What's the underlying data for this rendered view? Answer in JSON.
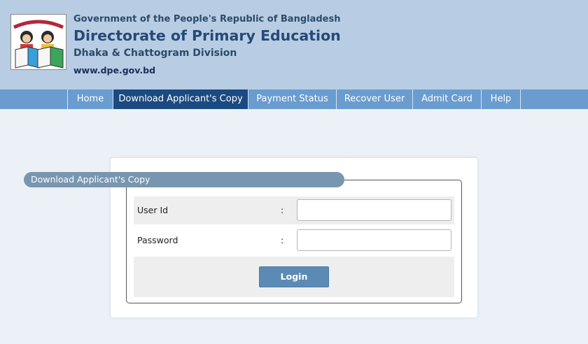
{
  "header": {
    "line1": "Government of the People's Republic of Bangladesh",
    "title": "Directorate of Primary Education",
    "division": "Dhaka & Chattogram Division",
    "website": "www.dpe.gov.bd",
    "logo_icon": "dpe-logo-icon"
  },
  "nav": {
    "items": [
      {
        "label": "Home"
      },
      {
        "label": "Download Applicant's Copy",
        "active": true
      },
      {
        "label": "Payment Status"
      },
      {
        "label": "Recover User"
      },
      {
        "label": "Admit Card"
      },
      {
        "label": "Help"
      }
    ]
  },
  "form": {
    "legend": "Download Applicant's Copy",
    "userid_label": "User Id",
    "password_label": "Password",
    "separator": ":",
    "userid_value": "",
    "password_value": "",
    "login_label": "Login"
  },
  "colors": {
    "header_bg": "#b8cde3",
    "nav_bg": "#6a9ccf",
    "nav_active": "#1b4a80",
    "legend_bg": "#7996b0",
    "button_bg": "#5b8ab5",
    "page_bg": "#ecf1f8"
  }
}
